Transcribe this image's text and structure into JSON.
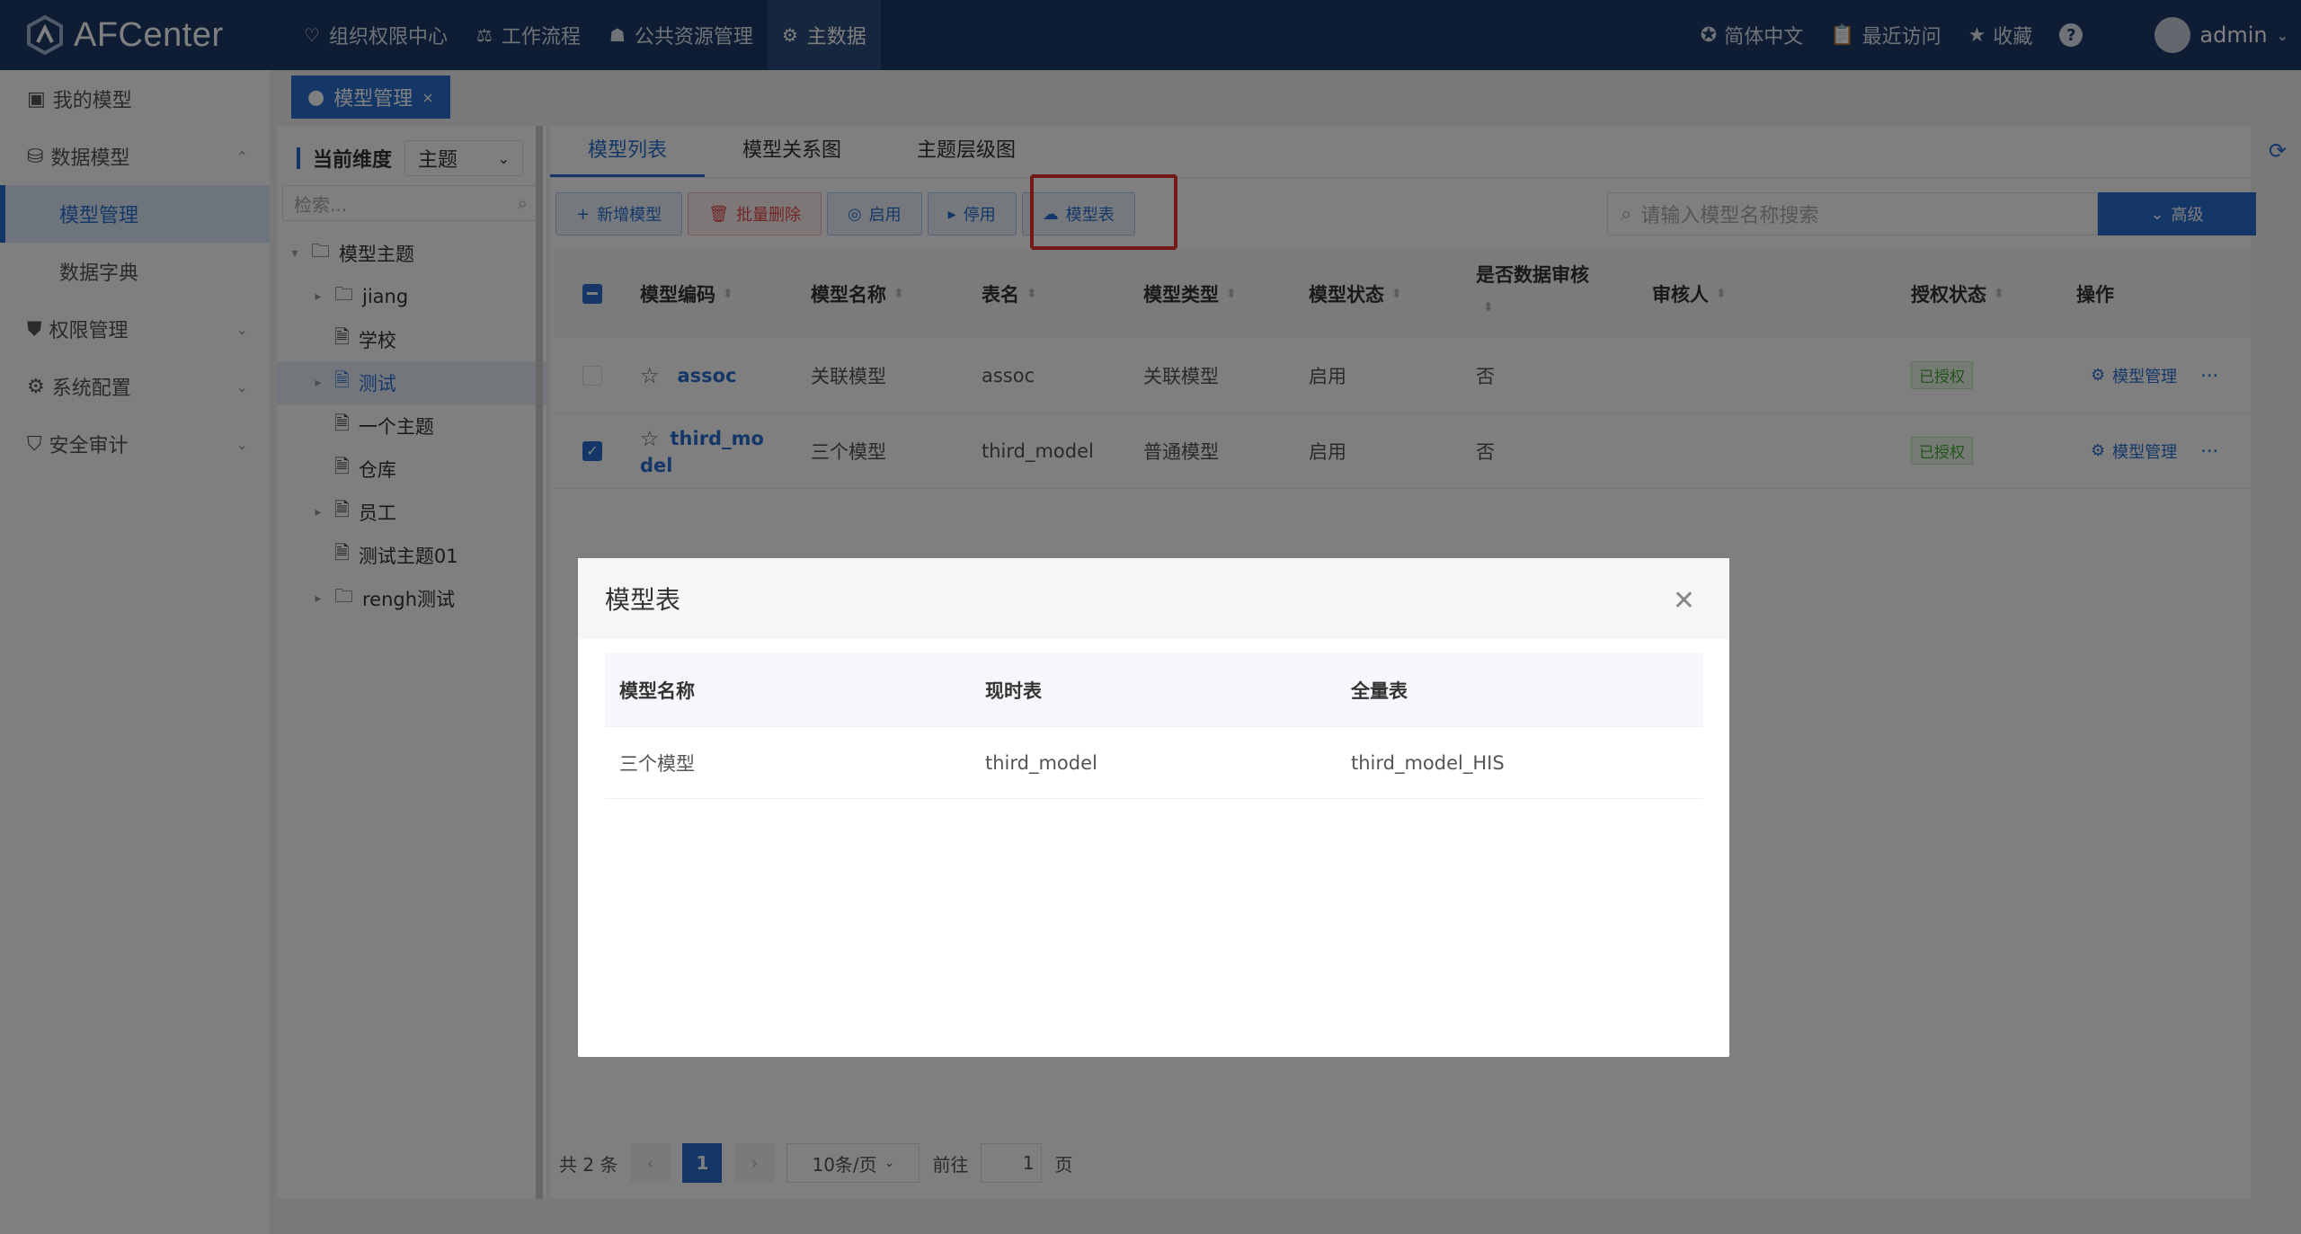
{
  "app": {
    "title": "AFCenter",
    "brand_color": "#1c3a66",
    "accent_color": "#2a6fd0"
  },
  "topnav": {
    "items": [
      {
        "label": "组织权限中心",
        "icon": "heart-shield-icon",
        "active": false
      },
      {
        "label": "工作流程",
        "icon": "scale-icon",
        "active": false
      },
      {
        "label": "公共资源管理",
        "icon": "users-icon",
        "active": false
      },
      {
        "label": "主数据",
        "icon": "sliders-icon",
        "active": true
      }
    ],
    "language": "简体中文",
    "recent": "最近访问",
    "favorites": "收藏",
    "help": "?",
    "user": "admin"
  },
  "sidebar": {
    "items": [
      {
        "label": "我的模型",
        "icon": "model-icon"
      },
      {
        "label": "数据模型",
        "icon": "database-icon",
        "expanded": true
      },
      {
        "label": "模型管理",
        "sub": true,
        "active": true
      },
      {
        "label": "数据字典",
        "sub": true
      },
      {
        "label": "权限管理",
        "icon": "shield-icon"
      },
      {
        "label": "系统配置",
        "icon": "gear-icon"
      },
      {
        "label": "安全审计",
        "icon": "audit-icon"
      }
    ]
  },
  "tabbar": {
    "active_tab": "模型管理"
  },
  "tree": {
    "dim_label": "当前维度",
    "dim_value": "主题",
    "search_placeholder": "检索...",
    "nodes": [
      {
        "label": "模型主题",
        "type": "folder",
        "toggle": "open"
      },
      {
        "label": "jiang",
        "type": "folder",
        "toggle": "closed"
      },
      {
        "label": "学校",
        "type": "doc",
        "toggle": "none"
      },
      {
        "label": "测试",
        "type": "doc",
        "toggle": "closed",
        "selected": true
      },
      {
        "label": "一个主题",
        "type": "doc",
        "toggle": "none"
      },
      {
        "label": "仓库",
        "type": "doc",
        "toggle": "none"
      },
      {
        "label": "员工",
        "type": "doc",
        "toggle": "closed"
      },
      {
        "label": "测试主题01",
        "type": "doc",
        "toggle": "none"
      },
      {
        "label": "rengh测试",
        "type": "folder",
        "toggle": "closed"
      }
    ]
  },
  "main": {
    "tabs": [
      "模型列表",
      "模型关系图",
      "主题层级图"
    ],
    "buttons": {
      "add": "新增模型",
      "batch_delete": "批量删除",
      "enable": "启用",
      "disable": "停用",
      "model_table": "模型表"
    },
    "search_placeholder": "请输入模型名称搜索",
    "advanced": "高级",
    "columns": [
      "模型编码",
      "模型名称",
      "表名",
      "模型类型",
      "模型状态",
      "是否数据审核",
      "审核人",
      "授权状态",
      "操作"
    ],
    "rows": [
      {
        "code": "assoc",
        "name": "关联模型",
        "table": "assoc",
        "type": "关联模型",
        "status": "启用",
        "audit": "否",
        "auditor": "",
        "auth": "已授权",
        "op": "模型管理",
        "checked": false
      },
      {
        "code_line1": "third_mo",
        "code_line2": "del",
        "name": "三个模型",
        "table": "third_model",
        "type": "普通模型",
        "status": "启用",
        "audit": "否",
        "auditor": "",
        "auth": "已授权",
        "op": "模型管理",
        "checked": true
      }
    ],
    "pagination": {
      "total": "共 2 条",
      "page": "1",
      "page_size": "10条/页",
      "goto": "前往",
      "goto_value": "1",
      "page_unit": "页"
    }
  },
  "modal": {
    "title": "模型表",
    "columns": [
      "模型名称",
      "现时表",
      "全量表"
    ],
    "rows": [
      {
        "name": "三个模型",
        "current": "third_model",
        "full": "third_model_HIS"
      }
    ]
  }
}
